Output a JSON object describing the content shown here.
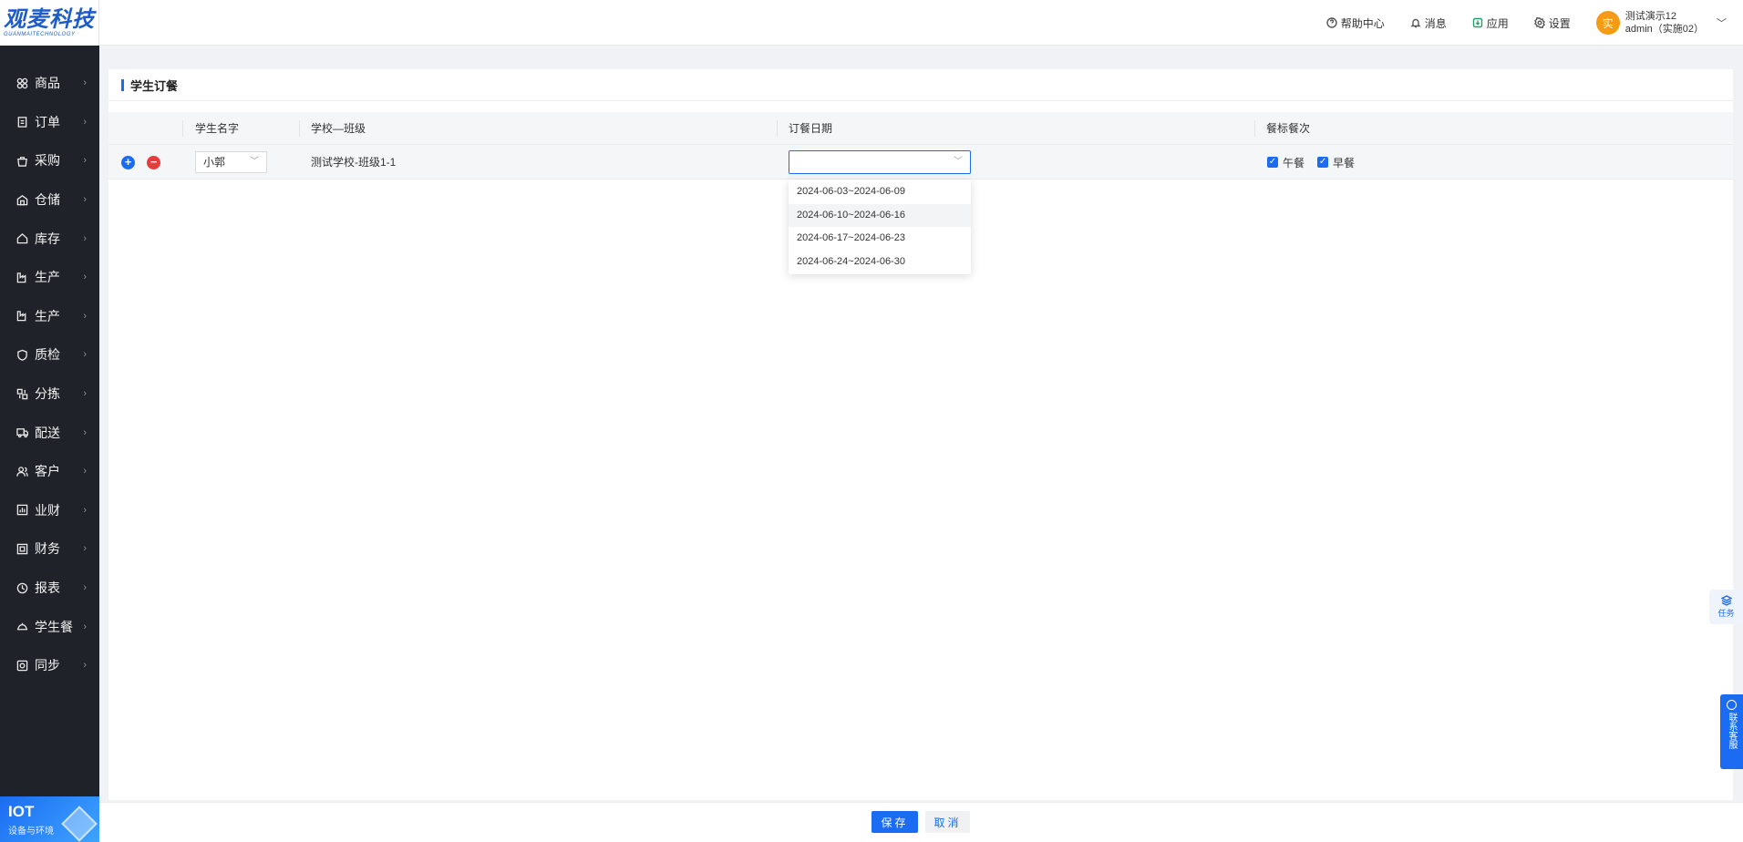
{
  "brand": {
    "logo_main": "观麦科技",
    "logo_sub": "GUANMAITECHNOLOGY"
  },
  "sidebar": {
    "items": [
      {
        "label": "商品",
        "icon": "grid-icon"
      },
      {
        "label": "订单",
        "icon": "clipboard-icon"
      },
      {
        "label": "采购",
        "icon": "basket-icon"
      },
      {
        "label": "仓储",
        "icon": "warehouse-icon"
      },
      {
        "label": "库存",
        "icon": "home-icon"
      },
      {
        "label": "生产",
        "icon": "factory-icon"
      },
      {
        "label": "生产",
        "icon": "factory-icon"
      },
      {
        "label": "质检",
        "icon": "shield-icon"
      },
      {
        "label": "分拣",
        "icon": "sort-icon"
      },
      {
        "label": "配送",
        "icon": "truck-icon"
      },
      {
        "label": "客户",
        "icon": "users-icon"
      },
      {
        "label": "业财",
        "icon": "bar-chart-icon"
      },
      {
        "label": "财务",
        "icon": "finance-icon"
      },
      {
        "label": "报表",
        "icon": "report-icon"
      },
      {
        "label": "学生餐",
        "icon": "meal-icon"
      },
      {
        "label": "同步",
        "icon": "sync-icon"
      }
    ],
    "iot_title": "IOT",
    "iot_sub": "设备与环境"
  },
  "header": {
    "help": "帮助中心",
    "messages": "消息",
    "apps": "应用",
    "settings": "设置",
    "user_avatar": "实",
    "user_name": "测试演示12",
    "user_account": "admin（实施02）"
  },
  "page": {
    "title": "学生订餐",
    "columns": [
      "学生名字",
      "学校—班级",
      "订餐日期",
      "餐标餐次"
    ],
    "row": {
      "student": "小郭",
      "school_class": "测试学校-班级1-1",
      "date_value": "",
      "meals": [
        "午餐",
        "早餐"
      ]
    },
    "date_options": [
      "2024-06-03~2024-06-09",
      "2024-06-10~2024-06-16",
      "2024-06-17~2024-06-23",
      "2024-06-24~2024-06-30"
    ]
  },
  "footer": {
    "save": "保存",
    "cancel": "取消"
  },
  "floating": {
    "task": "任务",
    "service": "联系客服"
  },
  "colors": {
    "primary": "#1b6cf2",
    "danger": "#e63c3c",
    "sidebar": "#1f2329",
    "avatar": "#f59a12"
  }
}
